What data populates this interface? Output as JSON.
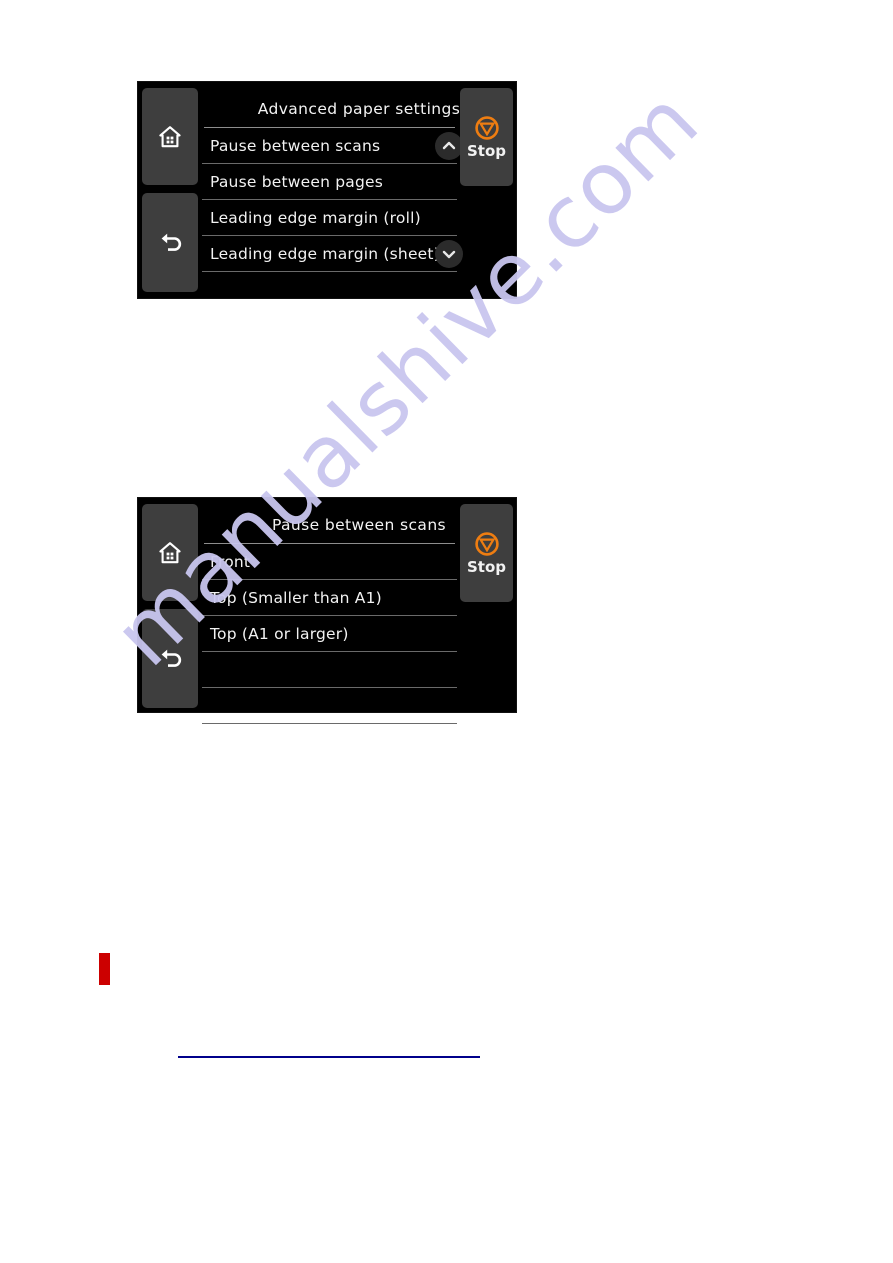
{
  "page": {
    "background_color": "#ffffff",
    "watermark_text": "manualshive.com",
    "watermark_color": "#c9c6ef"
  },
  "accent_colors": {
    "stop_orange": "#ee7d11",
    "panel_black": "#000000",
    "key_gray": "#3e3e3e",
    "red_marker": "#cc0000",
    "link_blue": "#00008b"
  },
  "panels": [
    {
      "id": "panel-advanced",
      "title": "Advanced paper settings",
      "side_keys": [
        {
          "name": "home-key",
          "icon": "home-icon"
        },
        {
          "name": "back-key",
          "icon": "back-arrow-icon"
        }
      ],
      "stop_key": {
        "label": "Stop",
        "icon": "stop-icon"
      },
      "scroll_up": {
        "icon": "chevron-up-icon",
        "visible": true
      },
      "scroll_down": {
        "icon": "chevron-down-icon",
        "visible": true
      },
      "rows": [
        {
          "label": "Pause between scans"
        },
        {
          "label": "Pause between pages"
        },
        {
          "label": "Leading edge margin (roll)"
        },
        {
          "label": "Leading edge margin (sheet)"
        }
      ]
    },
    {
      "id": "panel-pause",
      "title": "Pause between scans",
      "side_keys": [
        {
          "name": "home-key",
          "icon": "home-icon"
        },
        {
          "name": "back-key",
          "icon": "back-arrow-icon"
        }
      ],
      "stop_key": {
        "label": "Stop",
        "icon": "stop-icon"
      },
      "scroll_up": {
        "icon": "chevron-up-icon",
        "visible": false
      },
      "scroll_down": {
        "icon": "chevron-down-icon",
        "visible": false
      },
      "rows": [
        {
          "label": "Front"
        },
        {
          "label": "Top (Smaller than A1)"
        },
        {
          "label": "Top (A1 or larger)"
        },
        {
          "label": ""
        },
        {
          "label": ""
        }
      ]
    }
  ]
}
